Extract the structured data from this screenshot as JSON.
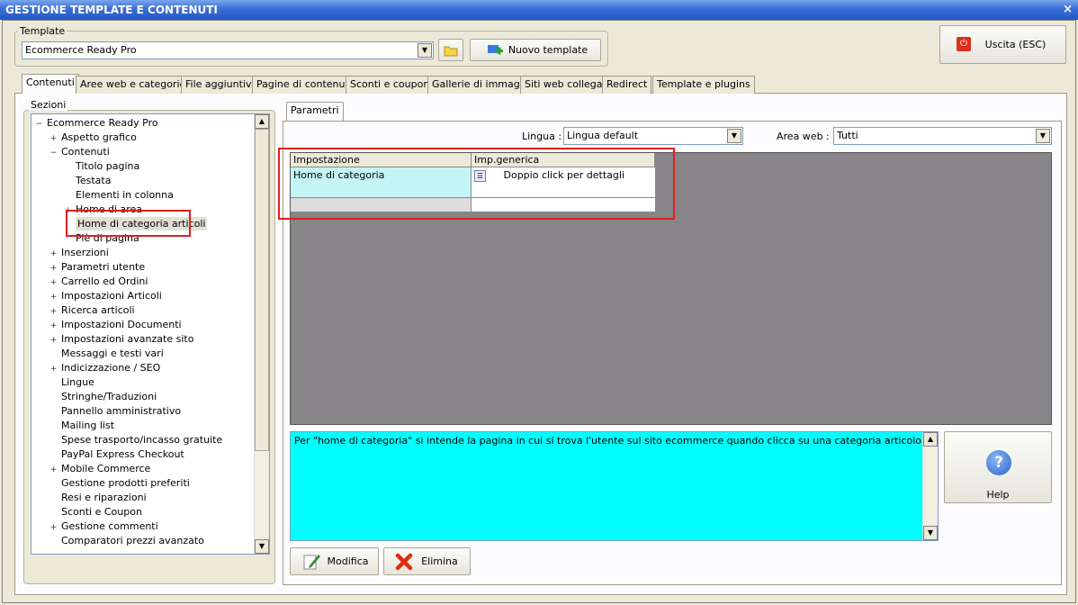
{
  "window": {
    "title": "GESTIONE TEMPLATE E CONTENUTI",
    "close": "×"
  },
  "template": {
    "group_label": "Template",
    "selected": "Ecommerce Ready Pro",
    "new_button": "Nuovo template"
  },
  "exit_button": "Uscita (ESC)",
  "tabs": [
    "Contenuti",
    "Aree web e categorie",
    "File aggiuntivi",
    "Pagine di contenuti",
    "Sconti e coupon",
    "Gallerie di immagini",
    "Siti web collegati",
    "Redirect",
    "Template e plugins"
  ],
  "sezioni": {
    "label": "Sezioni",
    "root": "Ecommerce Ready Pro",
    "items": [
      {
        "label": "Aspetto grafico",
        "exp": "+"
      },
      {
        "label": "Contenuti",
        "exp": "-"
      },
      {
        "label": "Titolo pagina",
        "exp": ""
      },
      {
        "label": "Testata",
        "exp": ""
      },
      {
        "label": "Elementi in colonna",
        "exp": ""
      },
      {
        "label": "Home di area",
        "exp": "+"
      },
      {
        "label": "Home di categoria articoli",
        "exp": ""
      },
      {
        "label": "Piè di pagina",
        "exp": ""
      },
      {
        "label": "Inserzioni",
        "exp": "+"
      },
      {
        "label": "Parametri utente",
        "exp": "+"
      },
      {
        "label": "Carrello ed Ordini",
        "exp": "+"
      },
      {
        "label": "Impostazioni Articoli",
        "exp": "+"
      },
      {
        "label": "Ricerca articoli",
        "exp": "+"
      },
      {
        "label": "Impostazioni Documenti",
        "exp": "+"
      },
      {
        "label": "Impostazioni avanzate sito",
        "exp": "+"
      },
      {
        "label": "Messaggi e testi vari",
        "exp": ""
      },
      {
        "label": "Indicizzazione / SEO",
        "exp": "+"
      },
      {
        "label": "Lingue",
        "exp": ""
      },
      {
        "label": "Stringhe/Traduzioni",
        "exp": ""
      },
      {
        "label": "Pannello amministrativo",
        "exp": ""
      },
      {
        "label": "Mailing list",
        "exp": ""
      },
      {
        "label": "Spese trasporto/incasso gratuite",
        "exp": ""
      },
      {
        "label": "PayPal Express Checkout",
        "exp": ""
      },
      {
        "label": "Mobile Commerce",
        "exp": "+"
      },
      {
        "label": "Gestione prodotti preferiti",
        "exp": ""
      },
      {
        "label": "Resi e riparazioni",
        "exp": ""
      },
      {
        "label": "Sconti e Coupon",
        "exp": ""
      },
      {
        "label": "Gestione commenti",
        "exp": "+"
      },
      {
        "label": "Comparatori prezzi avanzato",
        "exp": ""
      }
    ]
  },
  "parametri": {
    "tab": "Parametri",
    "lingua_label": "Lingua :",
    "lingua_value": "Lingua default",
    "area_label": "Area web :",
    "area_value": "Tutti",
    "grid": {
      "col1": "Impostazione",
      "col2": "Imp.generica",
      "row1_col1": "Home di categoria",
      "row1_col2": "Doppio click per dettagli"
    },
    "description": "Per \"home di categoria\" si intende la pagina in cui si trova l'utente sul sito ecommerce quando clicca su una categoria articolo.",
    "help": "Help",
    "modifica": "Modifica",
    "elimina": "Elimina"
  },
  "colors": {
    "selection": "#e3e0d5",
    "highlight": "#e02020",
    "desc_bg": "#00ffff",
    "grid_bg": "#878587",
    "cell_bg": "#c4f4f4"
  }
}
